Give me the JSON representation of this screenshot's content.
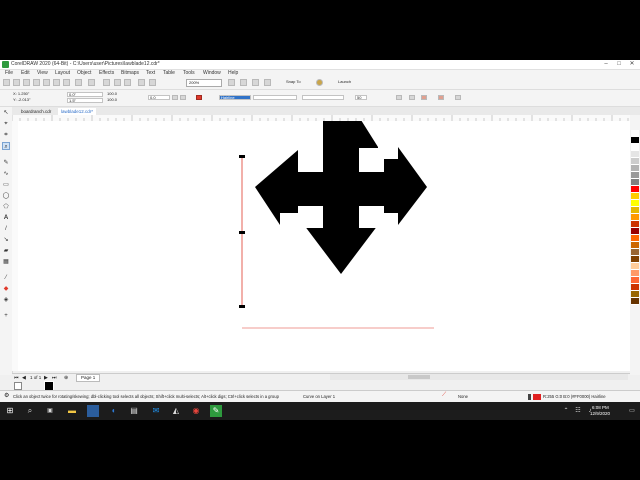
{
  "window": {
    "title": "CorelDRAW 2020 (64-Bit) - C:\\Users\\user\\Pictures\\lawblade12.cdr*"
  },
  "menu": [
    "File",
    "Edit",
    "View",
    "Layout",
    "Object",
    "Effects",
    "Bitmaps",
    "Text",
    "Table",
    "Tools",
    "Window",
    "Help"
  ],
  "toolbar": {
    "zoom": "200%",
    "snap_to": "Snap To",
    "launch": "Launch"
  },
  "property_bar": {
    "x": "X: 1.250\"",
    "y": "Y: -2.013\"",
    "w": "0.0\"",
    "h": "1.5\"",
    "scale_w": "100.0",
    "scale_h": "100.0",
    "angle": "0.0",
    "outline_width": "Hairline",
    "miter": "50"
  },
  "doc_tabs": [
    {
      "label": "boardranch.cdr",
      "active": false
    },
    {
      "label": "lawblade12.cdr*",
      "active": true
    }
  ],
  "page_bar": {
    "page_label": "Page 1",
    "page_counter": "1 of 1"
  },
  "status": {
    "hint": "Click an object twice for rotating/skewing; dbl-clicking tool selects all objects; Shift+click multi-selects; Alt+click digs; Ctrl+click selects in a group",
    "object_info": "Curve on Layer 1",
    "fill": "None",
    "outline": "R:255 G:0 B:0 (#FF0000)  Hairline"
  },
  "taskbar": {
    "search": "",
    "time": "6:08 PM",
    "date": "12/9/2020"
  },
  "colors": {
    "accent_red": "#e0392b",
    "taskbar": "#1c1c1c",
    "corel_green": "#2e9a3e"
  },
  "palette": [
    "#ffffff",
    "#000000",
    "#ffffff",
    "#e5e5e5",
    "#cccccc",
    "#b3b3b3",
    "#999999",
    "#808080",
    "#ff0000",
    "#ffcc00",
    "#ffff00",
    "#e6b800",
    "#ff9900",
    "#cc3300",
    "#990000",
    "#ff6600",
    "#cc6600",
    "#996633",
    "#804000",
    "#ffcc99",
    "#ff9966",
    "#ff6633",
    "#cc3300",
    "#996600",
    "#663300"
  ],
  "icons": {
    "pick_tool": "pick-tool-icon",
    "shape_tool": "shape-tool-icon",
    "crop_tool": "crop-tool-icon",
    "zoom_tool": "zoom-tool-icon",
    "text_tool": "text-tool-icon",
    "fill_tool": "fill-tool-icon"
  }
}
